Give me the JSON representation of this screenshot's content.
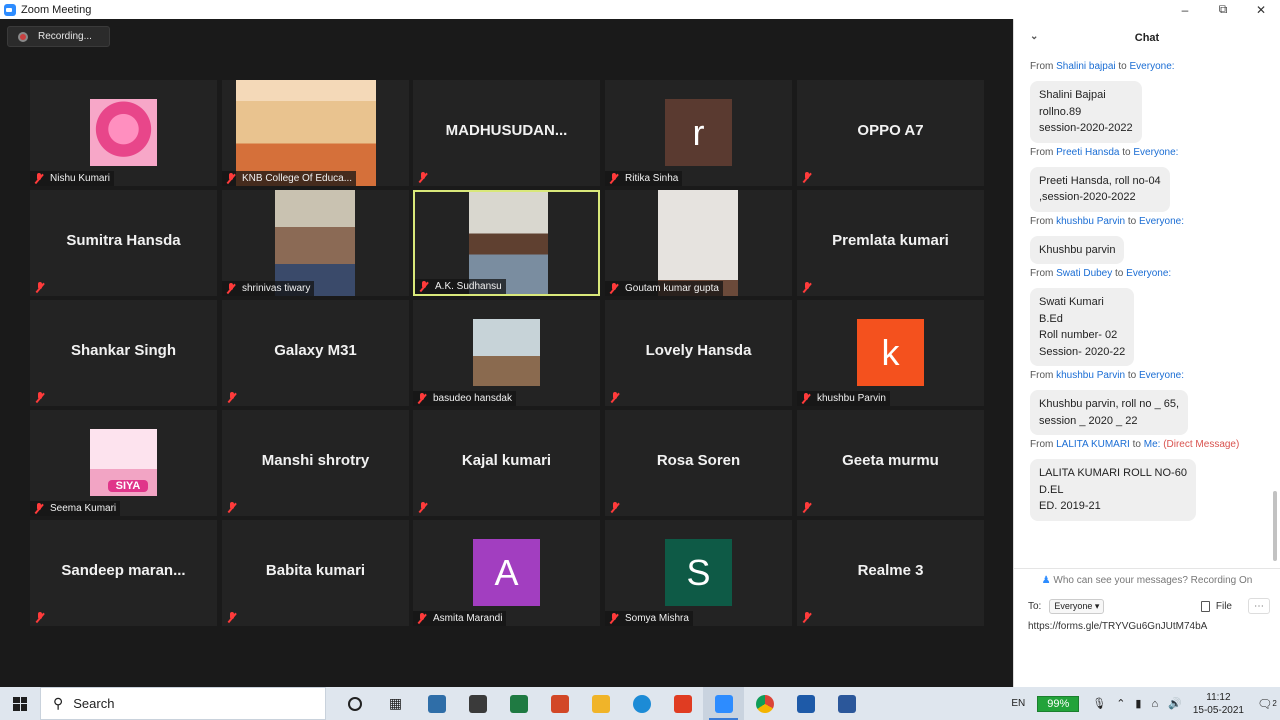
{
  "window": {
    "title": "Zoom Meeting"
  },
  "recording": {
    "label": "Recording..."
  },
  "tiles": [
    {
      "name": "Nishu Kumari",
      "big": "",
      "kind": "photo"
    },
    {
      "name": "KNB College Of Educa...",
      "big": "",
      "kind": "photo"
    },
    {
      "name": "",
      "big": "MADHUSUDAN...",
      "kind": "text"
    },
    {
      "name": "Ritika Sinha",
      "big": "",
      "kind": "avatar",
      "letter": "r",
      "color": "#5a3a30"
    },
    {
      "name": "",
      "big": "OPPO A7",
      "kind": "text"
    },
    {
      "name": "",
      "big": "Sumitra Hansda",
      "kind": "text"
    },
    {
      "name": "shrinivas tiwary",
      "big": "",
      "kind": "video"
    },
    {
      "name": "A.K. Sudhansu",
      "big": "",
      "kind": "video",
      "active": true
    },
    {
      "name": "Goutam kumar gupta",
      "big": "",
      "kind": "video"
    },
    {
      "name": "",
      "big": "Premlata kumari",
      "kind": "text"
    },
    {
      "name": "",
      "big": "Shankar Singh",
      "kind": "text"
    },
    {
      "name": "",
      "big": "Galaxy M31",
      "kind": "text"
    },
    {
      "name": "basudeo hansdak",
      "big": "",
      "kind": "photo"
    },
    {
      "name": "",
      "big": "Lovely Hansda",
      "kind": "text"
    },
    {
      "name": "khushbu Parvin",
      "big": "",
      "kind": "avatar",
      "letter": "k",
      "color": "#f4511e"
    },
    {
      "name": "Seema Kumari",
      "big": "",
      "kind": "photo",
      "caption": "SIYA"
    },
    {
      "name": "",
      "big": "Manshi shrotry",
      "kind": "text"
    },
    {
      "name": "",
      "big": "Kajal kumari",
      "kind": "text"
    },
    {
      "name": "",
      "big": "Rosa Soren",
      "kind": "text"
    },
    {
      "name": "",
      "big": "Geeta murmu",
      "kind": "text"
    },
    {
      "name": "",
      "big": "Sandeep  maran...",
      "kind": "text"
    },
    {
      "name": "",
      "big": "Babita kumari",
      "kind": "text"
    },
    {
      "name": "Asmita Marandi",
      "big": "",
      "kind": "avatar",
      "letter": "A",
      "color": "#a23ec0"
    },
    {
      "name": "Somya Mishra",
      "big": "",
      "kind": "avatar",
      "letter": "S",
      "color": "#0e5a46"
    },
    {
      "name": "",
      "big": "Realme 3",
      "kind": "text"
    }
  ],
  "chat": {
    "title": "Chat",
    "messages": [
      {
        "from_label": "From",
        "sender": "Shalini bajpai",
        "to_label": "to",
        "recipient": "Everyone:",
        "dm": "",
        "text": "Shalini Bajpai\nrollno.89\nsession-2020-2022"
      },
      {
        "from_label": "From",
        "sender": "Preeti Hansda",
        "to_label": "to",
        "recipient": "Everyone:",
        "dm": "",
        "text": "Preeti Hansda, roll no-04\n,session-2020-2022"
      },
      {
        "from_label": "From",
        "sender": "khushbu Parvin",
        "to_label": "to",
        "recipient": "Everyone:",
        "dm": "",
        "text": "Khushbu parvin"
      },
      {
        "from_label": "From",
        "sender": "Swati Dubey",
        "to_label": "to",
        "recipient": "Everyone:",
        "dm": "",
        "text": "Swati Kumari\nB.Ed\nRoll number- 02\nSession- 2020-22"
      },
      {
        "from_label": "From",
        "sender": "khushbu Parvin",
        "to_label": "to",
        "recipient": "Everyone:",
        "dm": "",
        "text": "Khushbu parvin, roll no _ 65,\nsession _ 2020 _ 22"
      },
      {
        "from_label": "From",
        "sender": "LALITA KUMARI",
        "to_label": "to",
        "recipient": "Me:",
        "dm": "(Direct Message)",
        "text": "LALITA KUMARI ROLL NO-60\nD.EL\nED. 2019-21"
      }
    ],
    "privacy_note": "Who can see your messages? Recording On",
    "to_label": "To:",
    "to_value": "Everyone",
    "file_label": "File",
    "compose_text": "https://forms.gle/TRYVGu6GnJUtM74bA"
  },
  "taskbar": {
    "search_placeholder": "Search",
    "lang": "EN",
    "battery": "99%",
    "time": "11:12",
    "date": "15-05-2021",
    "notif_count": "2"
  }
}
